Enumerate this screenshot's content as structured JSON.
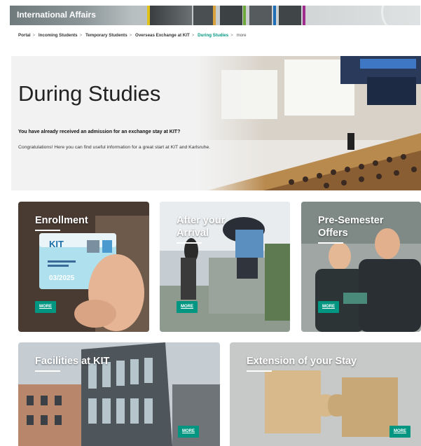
{
  "header": {
    "title": "International Affairs"
  },
  "breadcrumb": {
    "items": [
      "Portal",
      "Incoming Students",
      "Temporary Students",
      "Overseas Exchange at KIT"
    ],
    "current": "During Studies",
    "more": "more",
    "separator": ">"
  },
  "hero": {
    "title": "During Studies",
    "question": "You have already received an admission for an exchange stay at KIT?",
    "text": "Congratulations! Here you can find useful information for a great start at KIT and Karlsruhe."
  },
  "cards": [
    {
      "title_line1": "Enrollment",
      "title_line2": "",
      "button": "MORE",
      "card_text": "KIT",
      "card_date": "03/2025"
    },
    {
      "title_line1": "After your",
      "title_line2": "Arrival",
      "button": "MORE"
    },
    {
      "title_line1": "Pre-Semester",
      "title_line2": "Offers",
      "button": "MORE"
    },
    {
      "title_line1": "Facilities at KIT",
      "title_line2": "",
      "button": "MORE"
    },
    {
      "title_line1": "Extension of your Stay",
      "title_line2": "",
      "button": "MORE"
    }
  ],
  "colors": {
    "accent": "#009682",
    "stripe_yellow": "#e0c21a",
    "stripe_green": "#6fa83a",
    "stripe_blue": "#1e6fb8",
    "stripe_purple": "#a02c8c"
  }
}
